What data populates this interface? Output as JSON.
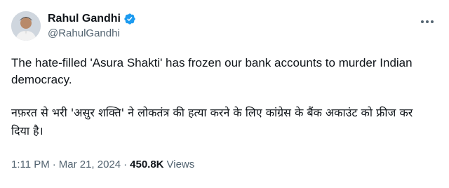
{
  "user": {
    "display_name": "Rahul Gandhi",
    "handle": "@RahulGandhi",
    "verified": true,
    "verified_color": "#1d9bf0"
  },
  "tweet": {
    "text_en": "The hate-filled 'Asura Shakti' has frozen our bank accounts to murder Indian democracy.",
    "text_hi": "नफ़रत से भरी 'असुर शक्ति' ने लोकतंत्र की हत्या करने के लिए कांग्रेस के बैंक अकाउंट को फ्रीज कर दिया है।"
  },
  "meta": {
    "time": "1:11 PM",
    "date": "Mar 21, 2024",
    "separator": "·",
    "views_count": "450.8K",
    "views_label": "Views"
  },
  "icons": {
    "more": "more-horizontal-icon",
    "verified": "verified-badge-icon"
  }
}
